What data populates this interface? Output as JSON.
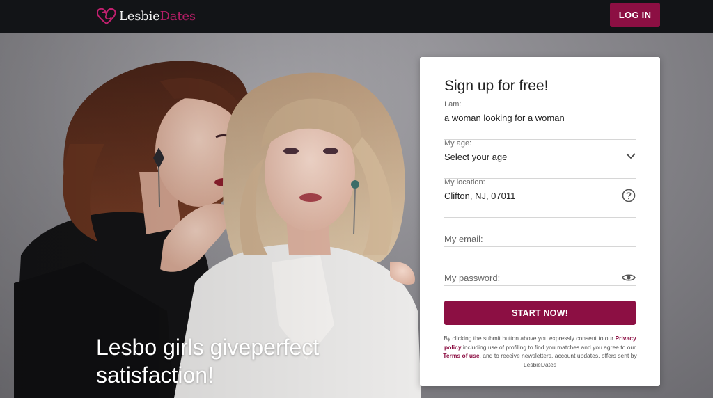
{
  "header": {
    "logo_part1": "Lesbie",
    "logo_part2": "Dates",
    "login_label": "LOG IN",
    "brand_color": "#8c0f43"
  },
  "hero": {
    "headline": "Lesbo girls giveperfect satisfaction!"
  },
  "signup": {
    "title": "Sign up for free!",
    "iam": {
      "label": "I am:",
      "value": "a woman looking for a woman"
    },
    "age": {
      "label": "My age:",
      "value": "Select your age",
      "icon": "chevron-down-icon"
    },
    "location": {
      "label": "My location:",
      "value": "Clifton, NJ, 07011",
      "icon": "question-circle-icon"
    },
    "email": {
      "placeholder": "My email:"
    },
    "password": {
      "placeholder": "My password:",
      "icon": "eye-icon"
    },
    "submit_label": "START NOW!",
    "legal": {
      "text1": "By clicking the submit button above you expressly consent to our ",
      "privacy_link": "Privacy policy",
      "text2": " including use of profiling to find you matches and you agree to our ",
      "terms_link": "Terms of use",
      "text3": ", and to receive newsletters, account updates, offers sent by LesbieDates"
    }
  }
}
